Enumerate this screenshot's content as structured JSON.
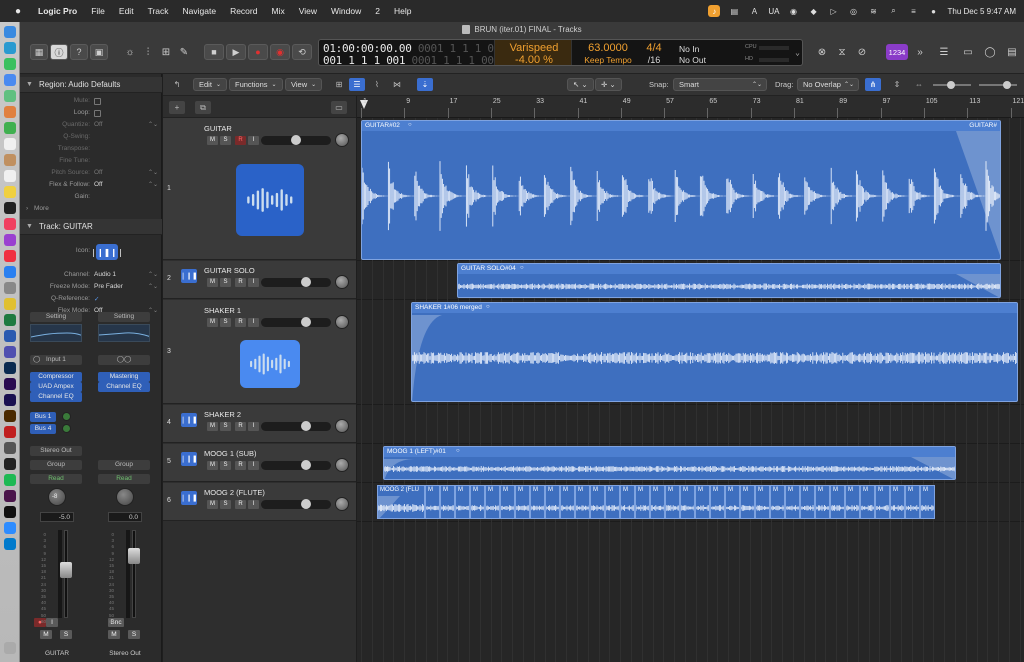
{
  "menubar": {
    "app": "Logic Pro",
    "items": [
      "File",
      "Edit",
      "Track",
      "Navigate",
      "Record",
      "Mix",
      "View",
      "Window",
      "2",
      "Help"
    ],
    "status_ua": "UA",
    "datetime": "Thu Dec 5  9:47 AM"
  },
  "window": {
    "title": "BRUN (iter.01) FINAL - Tracks"
  },
  "lcd": {
    "time": "01:00:00:00.00",
    "time_dim": " 0001 1 1 1 001",
    "bars": "001 1 1 1 001",
    "bars_dim": " 0001 1 1 1 001",
    "varispeed_label": "Varispeed",
    "varispeed_value": "-4.00 %",
    "tempo": "63.0000",
    "tempo_mode": "Keep Tempo",
    "sig": "4/4",
    "division": "/16",
    "in": "No In",
    "out": "No Out",
    "cpu_label": "CPU",
    "hd_label": "HD"
  },
  "toolbar": {
    "badge": "1234"
  },
  "inspector": {
    "region_header": "Region: Audio Defaults",
    "params": [
      {
        "label": "Mute:",
        "value": "",
        "type": "check",
        "dim": true
      },
      {
        "label": "Loop:",
        "value": "",
        "type": "check",
        "dim": false
      },
      {
        "label": "Quantize:",
        "value": "Off",
        "dim": true
      },
      {
        "label": "Q-Swing:",
        "value": "",
        "dim": true
      },
      {
        "label": "Transpose:",
        "value": "",
        "dim": true
      },
      {
        "label": "Fine Tune:",
        "value": "",
        "dim": true
      },
      {
        "label": "Pitch Source:",
        "value": "Off",
        "dim": true
      },
      {
        "label": "Flex & Follow:",
        "value": "Off",
        "dim": false
      },
      {
        "label": "Gain:",
        "value": "",
        "dim": false
      }
    ],
    "more_label": "More",
    "track_header": "Track:  GUITAR",
    "track_params": [
      {
        "label": "Icon:",
        "value": ""
      },
      {
        "label": "Channel:",
        "value": "Audio 1"
      },
      {
        "label": "Freeze Mode:",
        "value": "Pre Fader"
      },
      {
        "label": "Q-Reference:",
        "value": "✓"
      },
      {
        "label": "Flex Mode:",
        "value": "Off"
      }
    ]
  },
  "strips": [
    {
      "setting": "Setting",
      "input": "Input 1",
      "inserts": [
        "Compressor",
        "UAD Ampex",
        "Channel EQ"
      ],
      "sends": [
        "Bus 1",
        "Bus 4"
      ],
      "output": "Stereo Out",
      "group": "Group",
      "automation": "Read",
      "pan_value": "-8",
      "volume": "-5.0",
      "extra_label": "I",
      "mute": "M",
      "solo": "S",
      "name": "GUITAR"
    },
    {
      "setting": "Setting",
      "input": "",
      "inserts": [
        "Mastering",
        "Channel EQ"
      ],
      "sends": [],
      "output": "",
      "group": "Group",
      "automation": "Read",
      "pan_value": "",
      "volume": "0.0",
      "extra_label": "Bnc",
      "mute": "M",
      "solo": "S",
      "name": "Stereo Out"
    }
  ],
  "meter_scale": [
    "0",
    "3",
    "6",
    "9",
    "12",
    "15",
    "18",
    "21",
    "24",
    "30",
    "35",
    "40",
    "45",
    "50",
    "60"
  ],
  "arrange_header": {
    "edit": "Edit",
    "functions": "Functions",
    "view": "View",
    "snap_label": "Snap:",
    "snap_value": "Smart",
    "drag_label": "Drag:",
    "drag_value": "No Overlap"
  },
  "ruler": {
    "marks": [
      "1",
      "9",
      "17",
      "25",
      "33",
      "41",
      "49",
      "57",
      "65",
      "73",
      "81",
      "89",
      "97",
      "105",
      "113",
      "121"
    ]
  },
  "tracks": [
    {
      "num": "1",
      "name": "GUITAR",
      "mute": "M",
      "solo": "S",
      "rec": "R",
      "input": "I"
    },
    {
      "num": "2",
      "name": "GUITAR SOLO",
      "mute": "M",
      "solo": "S",
      "rec": "R",
      "input": "I"
    },
    {
      "num": "3",
      "name": "SHAKER 1",
      "mute": "M",
      "solo": "S",
      "rec": "R",
      "input": "I"
    },
    {
      "num": "4",
      "name": "SHAKER 2",
      "mute": "M",
      "solo": "S",
      "rec": "R",
      "input": "I"
    },
    {
      "num": "5",
      "name": "MOOG 1 (SUB)",
      "mute": "M",
      "solo": "S",
      "rec": "R",
      "input": "I"
    },
    {
      "num": "6",
      "name": "MOOG 2 (FLUTE)",
      "mute": "M",
      "solo": "S",
      "rec": "R",
      "input": "I"
    }
  ],
  "regions": [
    {
      "name": "GUITAR#02",
      "end_name": "GUITAR#"
    },
    {
      "name": "GUITAR SOLO#04"
    },
    {
      "name": "SHAKER 1#06 merged"
    },
    {
      "name": "MOOG 1 (LEFT)#01"
    },
    {
      "name": "MOOG 2 (FLU"
    }
  ],
  "mini_label": "M",
  "colors": {
    "region": "#3e6fbf",
    "accent": "#f0a030",
    "icon_blue": "#3a6ed0"
  }
}
